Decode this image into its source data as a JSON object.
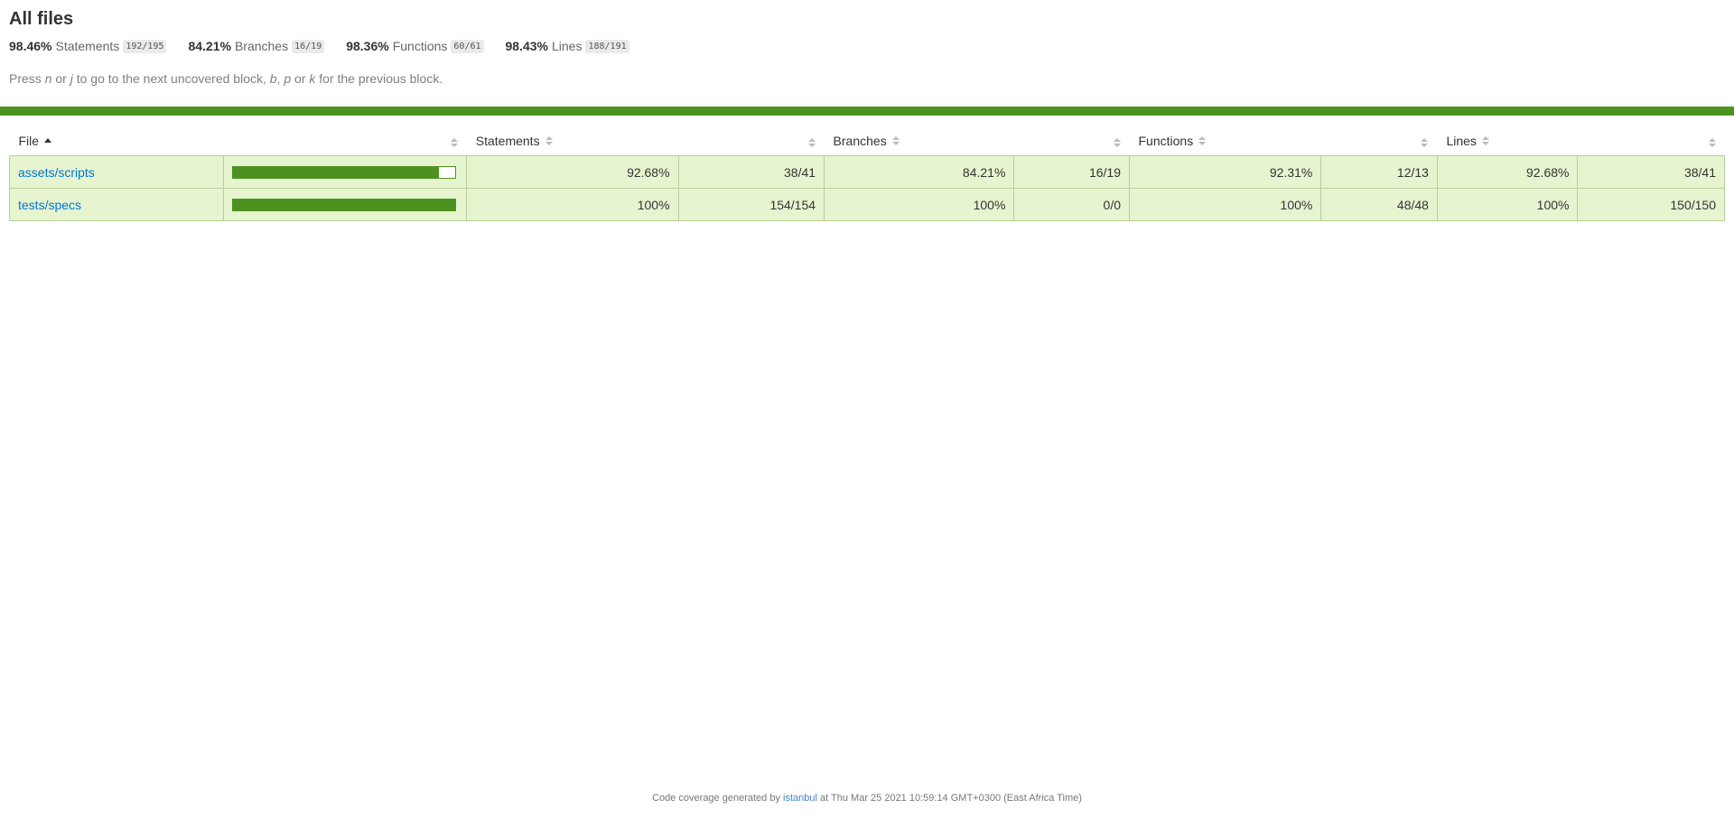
{
  "page": {
    "title": "All files",
    "hint_parts": [
      "Press ",
      "n",
      " or ",
      "j",
      " to go to the next uncovered block, ",
      "b",
      ", ",
      "p",
      " or ",
      "k",
      " for the previous block."
    ]
  },
  "summary": [
    {
      "pct": "98.46%",
      "label": "Statements",
      "fraction": "192/195"
    },
    {
      "pct": "84.21%",
      "label": "Branches",
      "fraction": "16/19"
    },
    {
      "pct": "98.36%",
      "label": "Functions",
      "fraction": "60/61"
    },
    {
      "pct": "98.43%",
      "label": "Lines",
      "fraction": "188/191"
    }
  ],
  "colors": {
    "status_high": "#4d9221",
    "row_high_bg": "#e6f5d0",
    "link": "#0074d9"
  },
  "table": {
    "headers": {
      "file": "File",
      "statements": "Statements",
      "branches": "Branches",
      "functions": "Functions",
      "lines": "Lines"
    },
    "rows": [
      {
        "file": "assets/scripts",
        "coverage_fraction": 0.9268,
        "statements_pct": "92.68%",
        "statements_frac": "38/41",
        "branches_pct": "84.21%",
        "branches_frac": "16/19",
        "functions_pct": "92.31%",
        "functions_frac": "12/13",
        "lines_pct": "92.68%",
        "lines_frac": "38/41"
      },
      {
        "file": "tests/specs",
        "coverage_fraction": 1.0,
        "statements_pct": "100%",
        "statements_frac": "154/154",
        "branches_pct": "100%",
        "branches_frac": "0/0",
        "functions_pct": "100%",
        "functions_frac": "48/48",
        "lines_pct": "100%",
        "lines_frac": "150/150"
      }
    ]
  },
  "footer": {
    "prefix": "Code coverage generated by",
    "link": "istanbul",
    "suffix": "at Thu Mar 25 2021 10:59:14 GMT+0300 (East Africa Time)"
  }
}
